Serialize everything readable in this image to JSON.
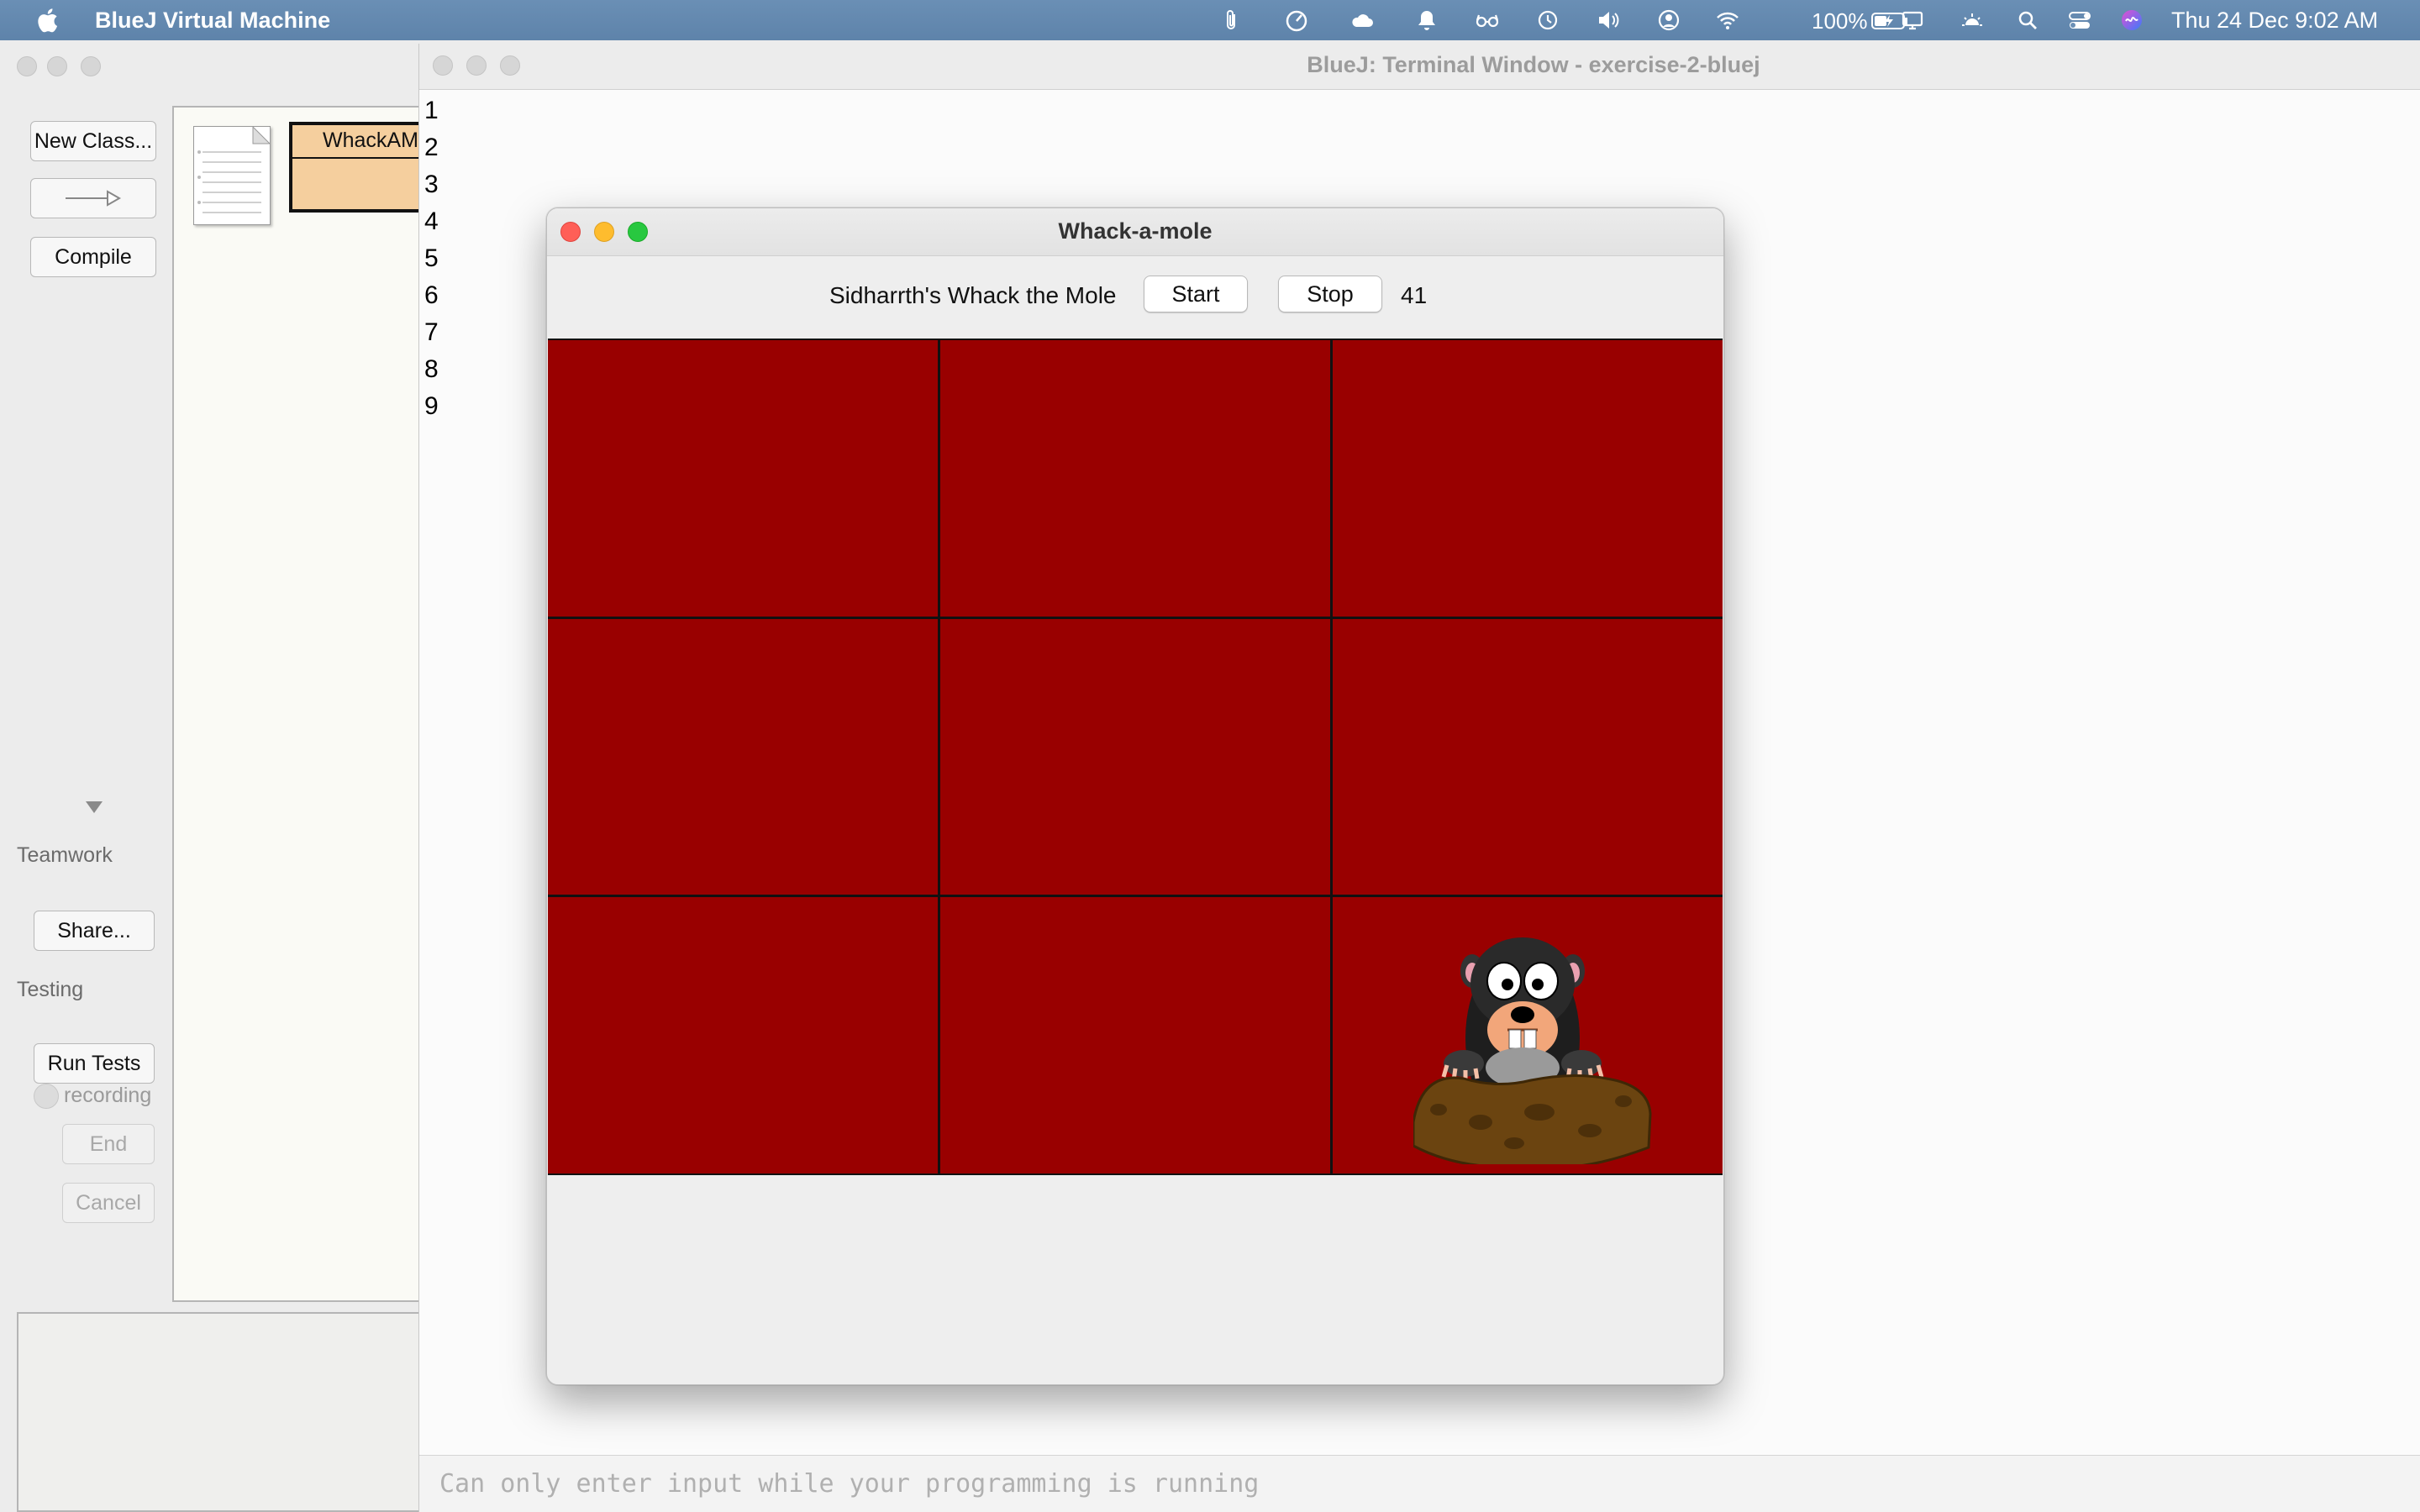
{
  "menubar": {
    "app_name": "BlueJ Virtual Machine",
    "battery": "100%",
    "clock": "Thu 24 Dec  9:02 AM",
    "status_icons": [
      "paperclip-icon",
      "speedometer-icon",
      "cloud-icon",
      "notification-icon",
      "glasses-icon",
      "time-machine-icon",
      "volume-icon",
      "user-icon",
      "wifi-icon",
      "battery-icon",
      "display-icon",
      "brightness-icon",
      "spotlight-icon",
      "control-center-icon",
      "siri-icon"
    ]
  },
  "bluej": {
    "buttons": {
      "new_class": "New Class...",
      "compile": "Compile",
      "share": "Share...",
      "run_tests": "Run Tests",
      "end": "End",
      "cancel": "Cancel"
    },
    "labels": {
      "teamwork": "Teamwork",
      "testing": "Testing",
      "recording": "recording"
    },
    "class_name": "WhackAM"
  },
  "terminal": {
    "title": "BlueJ: Terminal Window - exercise-2-bluej",
    "lines": [
      "1",
      "2",
      "3",
      "4",
      "5",
      "6",
      "7",
      "8",
      "9"
    ],
    "input_placeholder": "Can only enter input while your programming is running"
  },
  "game": {
    "window_title": "Whack-a-mole",
    "label": "Sidharrth's Whack the Mole",
    "start_label": "Start",
    "stop_label": "Stop",
    "score": "41",
    "grid_rows": 3,
    "grid_cols": 3,
    "mole_cell": 8,
    "colors": {
      "cell": "#990000",
      "grid_line": "#111111"
    }
  }
}
